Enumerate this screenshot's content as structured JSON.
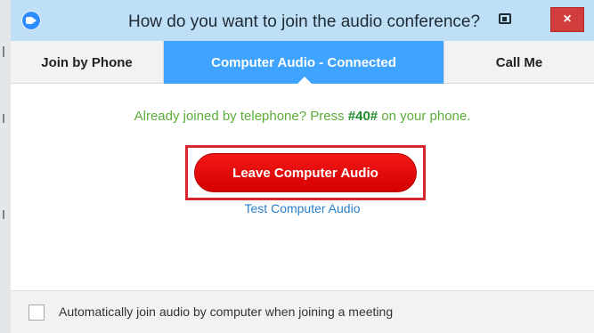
{
  "window": {
    "title": "How do you want to join the audio conference?",
    "close_label": "×"
  },
  "tabs": [
    {
      "label": "Join by Phone",
      "active": false
    },
    {
      "label": "Computer Audio - Connected",
      "active": true
    },
    {
      "label": "Call Me",
      "active": false
    }
  ],
  "content": {
    "info_before": "Already joined by telephone? Press ",
    "info_code": "#40#",
    "info_after": " on your phone.",
    "leave_button_label": "Leave Computer Audio",
    "test_link_label": "Test Computer Audio"
  },
  "footer": {
    "auto_join_checked": false,
    "auto_join_label": "Automatically join audio by computer when joining a meeting"
  },
  "colors": {
    "accent_blue": "#3ea4ff",
    "titlebar": "#bedff6",
    "leave_red": "#e80c0c",
    "highlight_red": "#d8262d",
    "info_green": "#5cae39",
    "link_blue": "#2a7fc9"
  },
  "icons": {
    "app": "zoom-camera-icon",
    "snap": "window-snap-icon",
    "close": "close-icon",
    "checkbox": "checkbox-unchecked-icon"
  }
}
